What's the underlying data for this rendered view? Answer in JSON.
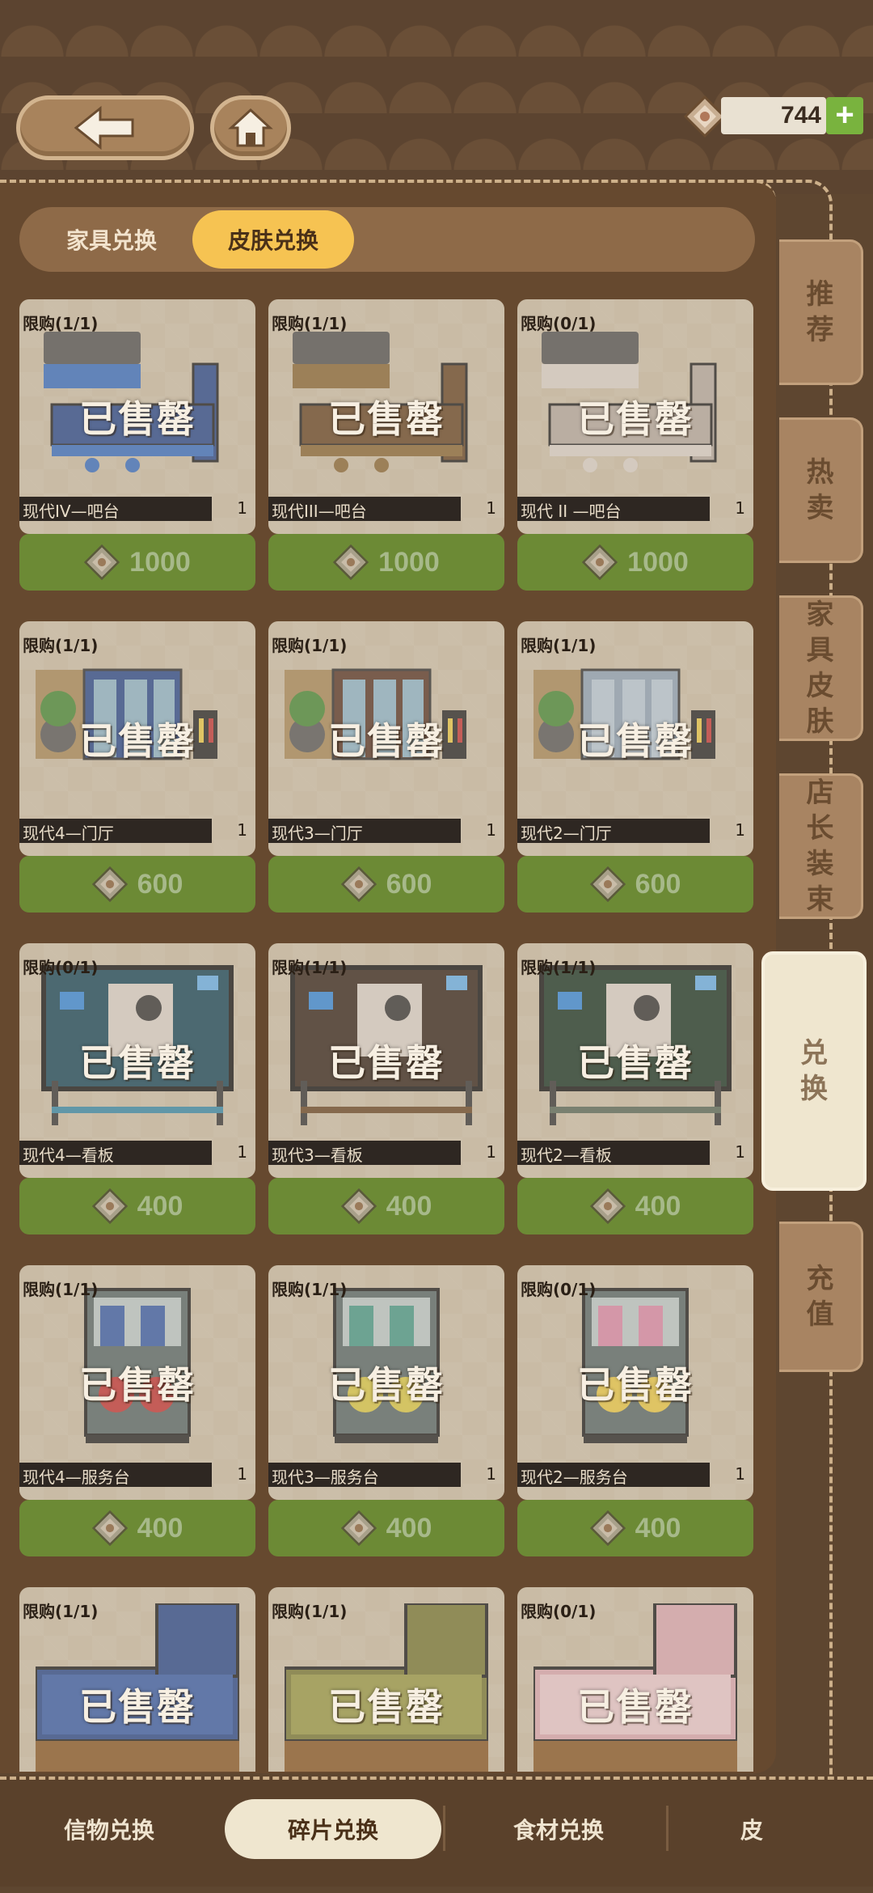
{
  "header": {
    "back_icon": "arrow-left-icon",
    "home_icon": "home-icon",
    "currency_amount": "744",
    "add_label": "+"
  },
  "top_tabs": [
    "家具兑换",
    "皮肤兑换"
  ],
  "side_tabs": [
    "推荐",
    "热卖",
    "家具皮肤",
    "店长装束",
    "兑换",
    "充值"
  ],
  "bottom_tabs": [
    "信物兑换",
    "碎片兑换",
    "食材兑换",
    "皮"
  ],
  "sold_label": "已售罄",
  "items": [
    {
      "limit": "限购(1/1)",
      "name": "现代IV—吧台",
      "count": "1",
      "price": "1000",
      "kind": "bar",
      "c1": "#2d4b8c",
      "c2": "#3b6fbf"
    },
    {
      "limit": "限购(1/1)",
      "name": "现代III—吧台",
      "count": "1",
      "price": "1000",
      "kind": "bar",
      "c1": "#6b4a2a",
      "c2": "#8b6a3a"
    },
    {
      "limit": "限购(0/1)",
      "name": "现代 II —吧台",
      "count": "1",
      "price": "1000",
      "kind": "bar",
      "c1": "#b5aaa0",
      "c2": "#d8d0c8"
    },
    {
      "limit": "限购(1/1)",
      "name": "现代4—门厅",
      "count": "1",
      "price": "600",
      "kind": "door",
      "c1": "#2d4b8c",
      "c2": "#8fb5c8"
    },
    {
      "limit": "限购(1/1)",
      "name": "现代3—门厅",
      "count": "1",
      "price": "600",
      "kind": "door",
      "c1": "#5a3a2a",
      "c2": "#8fb5c8"
    },
    {
      "limit": "限购(1/1)",
      "name": "现代2—门厅",
      "count": "1",
      "price": "600",
      "kind": "door",
      "c1": "#8fa2b6",
      "c2": "#b8c8d6"
    },
    {
      "limit": "限购(0/1)",
      "name": "现代4—看板",
      "count": "1",
      "price": "400",
      "kind": "board",
      "c1": "#1c4a5c",
      "c2": "#3a8aa8"
    },
    {
      "limit": "限购(1/1)",
      "name": "现代3—看板",
      "count": "1",
      "price": "400",
      "kind": "board",
      "c1": "#3a2a20",
      "c2": "#6b4a2a"
    },
    {
      "limit": "限购(1/1)",
      "name": "现代2—看板",
      "count": "1",
      "price": "400",
      "kind": "board",
      "c1": "#1f3a2a",
      "c2": "#5a6a5a"
    },
    {
      "limit": "限购(1/1)",
      "name": "现代4—服务台",
      "count": "1",
      "price": "400",
      "kind": "stand",
      "c1": "#3b5fa8",
      "c2": "#c23a3a"
    },
    {
      "limit": "限购(1/1)",
      "name": "现代3—服务台",
      "count": "1",
      "price": "400",
      "kind": "stand",
      "c1": "#4a9a8a",
      "c2": "#d8c84a"
    },
    {
      "limit": "限购(0/1)",
      "name": "现代2—服务台",
      "count": "1",
      "price": "400",
      "kind": "stand",
      "c1": "#d88aa8",
      "c2": "#e8c84a"
    },
    {
      "limit": "限购(1/1)",
      "name": "",
      "count": "",
      "price": "",
      "kind": "counter",
      "c1": "#2d4b8c",
      "c2": "#3b5fa8"
    },
    {
      "limit": "限购(1/1)",
      "name": "",
      "count": "",
      "price": "",
      "kind": "counter",
      "c1": "#7a7a3a",
      "c2": "#9a9a4a"
    },
    {
      "limit": "限购(0/1)",
      "name": "",
      "count": "",
      "price": "",
      "kind": "counter",
      "c1": "#d8a8b0",
      "c2": "#e8c8cc"
    }
  ]
}
